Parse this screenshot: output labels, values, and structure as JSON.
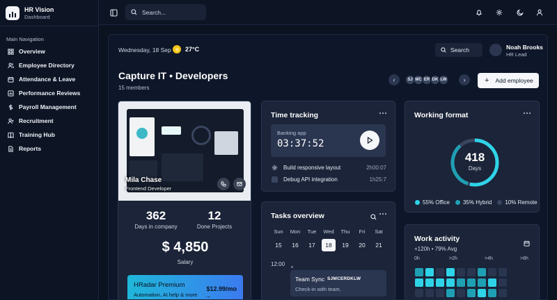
{
  "brand": {
    "name": "HR Vision",
    "subtitle": "Dashboard"
  },
  "sidebar": {
    "section_title": "Main Navigation",
    "items": [
      {
        "label": "Overview",
        "icon": "grid-icon"
      },
      {
        "label": "Employee Directory",
        "icon": "users-icon"
      },
      {
        "label": "Attendance & Leave",
        "icon": "calendar-icon"
      },
      {
        "label": "Performance Reviews",
        "icon": "chart-icon"
      },
      {
        "label": "Payroll Management",
        "icon": "dollar-icon"
      },
      {
        "label": "Recruitment",
        "icon": "user-plus-icon"
      },
      {
        "label": "Training Hub",
        "icon": "book-icon"
      },
      {
        "label": "Reports",
        "icon": "file-icon"
      }
    ]
  },
  "topbar": {
    "search_placeholder": "Search..."
  },
  "header": {
    "date": "Wednesday, 18 Sep",
    "temperature": "27°C",
    "search_label": "Search",
    "user": {
      "name": "Noah Brooks",
      "role": "HR Lead"
    }
  },
  "team": {
    "title": "Capture IT • Developers",
    "members": "15 members",
    "avatars": [
      "SJ",
      "MC",
      "ER",
      "DK",
      "LW"
    ],
    "add_button": "Add employee"
  },
  "profile": {
    "name": "Mila Chase",
    "role": "Frontend Developer",
    "stats": [
      {
        "value": "362",
        "label": "Days in company"
      },
      {
        "value": "12",
        "label": "Done Projects"
      }
    ],
    "salary": "$ 4,850",
    "salary_label": "Salary",
    "premium": {
      "title": "HRadar Premium",
      "price": "$12.99/mo",
      "desc": "Automation, AI help & more",
      "arrow": "→"
    }
  },
  "time_tracking": {
    "title": "Time tracking",
    "project": "Banking app",
    "timer": "03:37:52",
    "tasks": [
      {
        "label": "Build responsive layout",
        "time": "2h00:07",
        "icon": "gear-icon"
      },
      {
        "label": "Debug API integration",
        "time": "1h25:7",
        "icon": "checkbox-icon"
      }
    ]
  },
  "working_format": {
    "title": "Working format",
    "total": "418",
    "unit": "Days",
    "legend": [
      {
        "label": "55% Office",
        "color": "#2fd3e8",
        "share": 55
      },
      {
        "label": "35% Hybrid",
        "color": "#1f9fb4",
        "share": 35
      },
      {
        "label": "10% Remote",
        "color": "#3a4660",
        "share": 10
      }
    ]
  },
  "tasks_overview": {
    "title": "Tasks overview",
    "days": [
      "Sun",
      "Mon",
      "Tue",
      "Wed",
      "Thu",
      "Fri",
      "Sat"
    ],
    "dates": [
      "15",
      "16",
      "17",
      "18",
      "19",
      "20",
      "21"
    ],
    "selected": "18",
    "time_label": "12:00",
    "event": {
      "title": "Team Sync",
      "people": "SJMCERDKLW",
      "desc": "Check-in with team."
    }
  },
  "work_activity": {
    "title": "Work activity",
    "summary": "+120h • 79% Avg",
    "scale": [
      "0h",
      ">2h",
      ">4h",
      ">8h"
    ]
  },
  "colors": {
    "accent": "#2fd3e8",
    "panel": "#1b2438",
    "background": "#0b1220"
  }
}
